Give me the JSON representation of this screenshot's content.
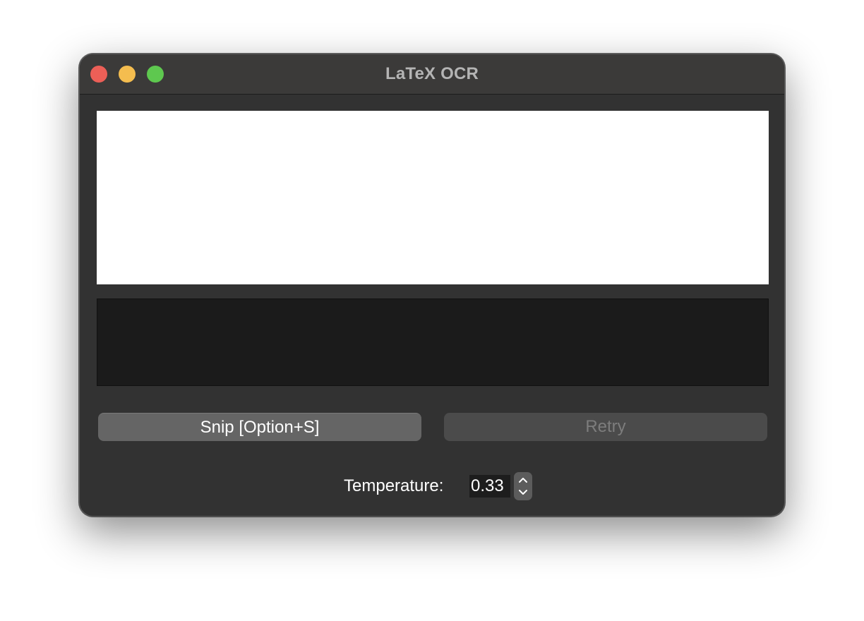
{
  "window": {
    "title": "LaTeX OCR"
  },
  "buttons": {
    "snip_label": "Snip [Option+S]",
    "retry_label": "Retry",
    "retry_enabled": false
  },
  "temperature": {
    "label": "Temperature:",
    "value": "0.33"
  },
  "icons": {
    "stepper_up": "chevron-up-icon",
    "stepper_down": "chevron-down-icon"
  },
  "colors": {
    "close": "#ec5f57",
    "minimize": "#f4bd4f",
    "maximize": "#5ec84f"
  }
}
